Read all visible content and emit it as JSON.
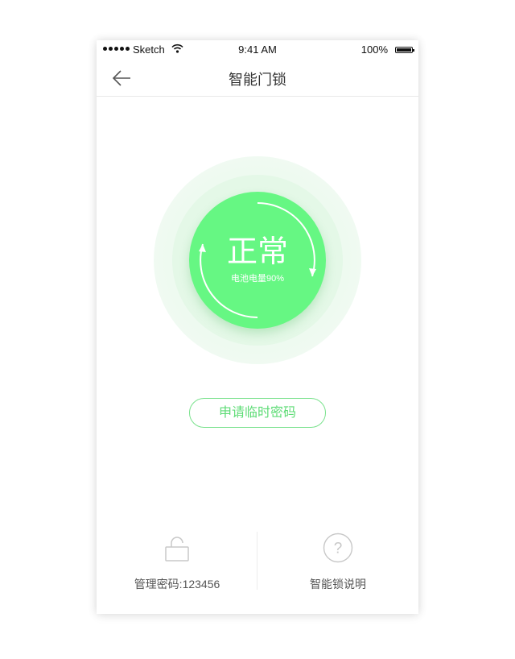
{
  "status_bar": {
    "carrier": "Sketch",
    "time": "9:41 AM",
    "battery": "100%"
  },
  "nav": {
    "title": "智能门锁",
    "back_icon": "arrow-left-icon"
  },
  "lock_status": {
    "state": "正常",
    "battery_text": "电池电量90%",
    "battery_level": 90,
    "accent_color": "#66f783"
  },
  "actions": {
    "temp_password_label": "申请临时密码"
  },
  "bottom": {
    "manage_password_label": "管理密码:123456",
    "manage_icon": "unlock-icon",
    "help_label": "智能锁说明",
    "help_icon": "question-circle-icon"
  }
}
